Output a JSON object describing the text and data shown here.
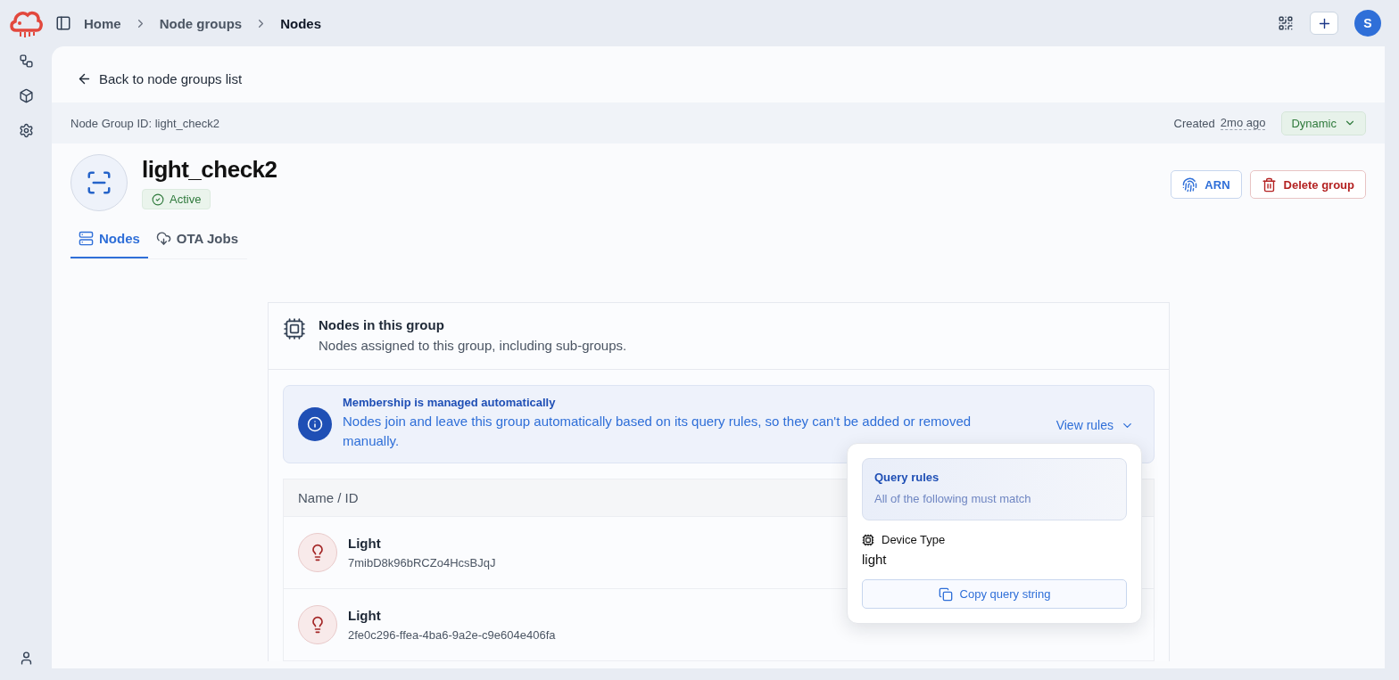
{
  "breadcrumbs": [
    {
      "label": "Home",
      "current": false
    },
    {
      "label": "Node groups",
      "current": false
    },
    {
      "label": "Nodes",
      "current": true
    }
  ],
  "account": {
    "avatar": "S"
  },
  "back_link": "Back to node groups list",
  "meta": {
    "id_label": "Node Group ID: light_check2",
    "created_label": "Created",
    "created_value": "2mo ago",
    "type": "Dynamic"
  },
  "group": {
    "name": "light_check2",
    "status": "Active"
  },
  "actions": [
    {
      "kind": "arn",
      "label": "ARN"
    },
    {
      "kind": "delete",
      "label": "Delete group"
    }
  ],
  "tabs": [
    {
      "kind": "nodes",
      "label": "Nodes",
      "selected": true
    },
    {
      "kind": "ota",
      "label": "OTA Jobs",
      "selected": false
    }
  ],
  "card": {
    "title": "Nodes in this group",
    "subtitle": "Nodes assigned to this group, including sub-groups."
  },
  "banner": {
    "title": "Membership is managed automatically",
    "text": "Nodes join and leave this group automatically based on its query rules, so they can't be added or removed manually.",
    "toggle": "View rules",
    "expanded": true
  },
  "popover": {
    "title": "Query rules",
    "subtitle": "All of the following must match",
    "rules": [
      {
        "field": "Device Type",
        "value": "light"
      }
    ],
    "copy_button": "Copy query string"
  },
  "table": {
    "columns": [
      "Name / ID"
    ],
    "rows": [
      {
        "name": "Light",
        "id": "7mibD8k96bRCZo4HcsBJqJ"
      },
      {
        "name": "Light",
        "id": "2fe0c296-ffea-4ba6-9a2e-c9e604e406fa"
      }
    ]
  }
}
